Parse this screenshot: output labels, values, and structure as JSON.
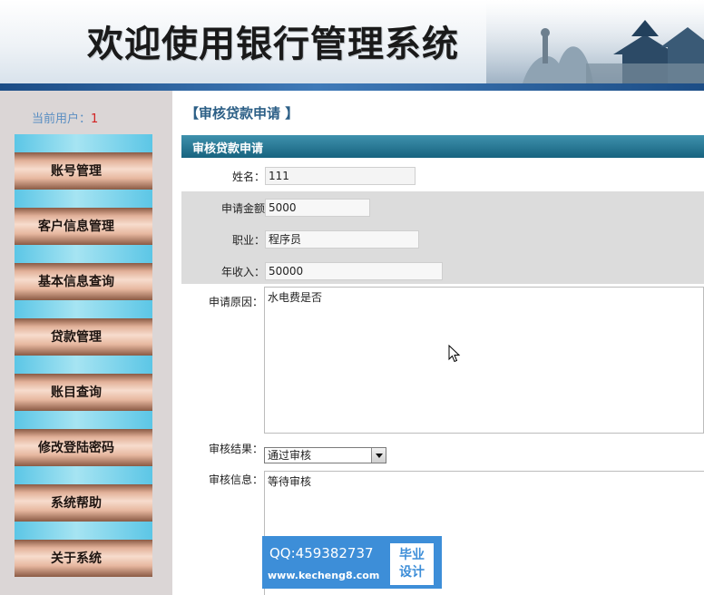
{
  "header": {
    "title": "欢迎使用银行管理系统"
  },
  "sidebar": {
    "current_user_label": "当前用户：",
    "current_user_value": "1",
    "items": [
      {
        "label": "账号管理"
      },
      {
        "label": "客户信息管理"
      },
      {
        "label": "基本信息查询"
      },
      {
        "label": "贷款管理"
      },
      {
        "label": "账目查询"
      },
      {
        "label": "修改登陆密码"
      },
      {
        "label": "系统帮助"
      },
      {
        "label": "关于系统"
      }
    ]
  },
  "main": {
    "page_title": "【审核贷款申请 】",
    "section_title": "审核贷款申请",
    "form": {
      "name_label": "姓名：",
      "name_value": "111",
      "amount_label": "申请金额",
      "amount_value": "5000",
      "job_label": "职业：",
      "job_value": "程序员",
      "income_label": "年收入：",
      "income_value": "50000",
      "reason_label": "申请原因：",
      "reason_value": "水电费是否",
      "result_label": "审核结果：",
      "result_selected": "通过审核",
      "info_label": "审核信息：",
      "info_value": "等待审核"
    }
  },
  "watermark": {
    "qq": "QQ:459382737",
    "url": "www.kecheng8.com",
    "badge": "毕业\n设计"
  },
  "colors": {
    "sidebar_bg": "#dbd6d6",
    "menu_cyan": "#5cc6e6",
    "menu_brown": "#8a5a44",
    "section_bar": "#17637f",
    "page_title": "#2c5f86",
    "watermark_blue": "#3d8ed8"
  }
}
